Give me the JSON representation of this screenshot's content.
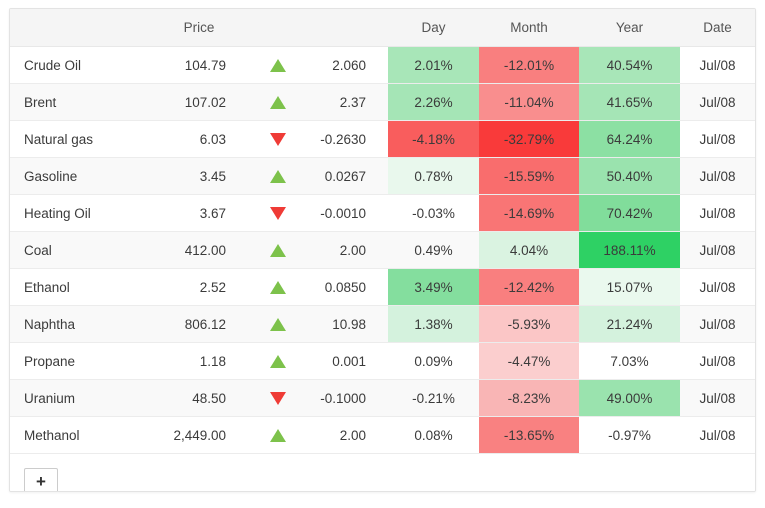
{
  "table": {
    "headers": {
      "name": "",
      "price": "Price",
      "arrow": "",
      "change": "",
      "day": "Day",
      "month": "Month",
      "year": "Year",
      "date": "Date"
    },
    "rows": [
      {
        "name": "Crude Oil",
        "price": "104.79",
        "direction": "up",
        "change": "2.060",
        "day": "2.01%",
        "month": "-12.01%",
        "year": "40.54%",
        "date": "Jul/08",
        "day_bg": "#a8e6b8",
        "month_bg": "#f97f7f",
        "year_bg": "#a8e6b8",
        "day_value": 2.01,
        "month_value": -12.01,
        "year_value": 40.54
      },
      {
        "name": "Brent",
        "price": "107.02",
        "direction": "up",
        "change": "2.37",
        "day": "2.26%",
        "month": "-11.04%",
        "year": "41.65%",
        "date": "Jul/08",
        "day_bg": "#a5e5b6",
        "month_bg": "#f98e8e",
        "year_bg": "#a5e5b6",
        "day_value": 2.26,
        "month_value": -11.04,
        "year_value": 41.65
      },
      {
        "name": "Natural gas",
        "price": "6.03",
        "direction": "down",
        "change": "-0.2630",
        "day": "-4.18%",
        "month": "-32.79%",
        "year": "64.24%",
        "date": "Jul/08",
        "day_bg": "#f95d5d",
        "month_bg": "#f93a3a",
        "year_bg": "#8ce0a3",
        "day_value": -4.18,
        "month_value": -32.79,
        "year_value": 64.24
      },
      {
        "name": "Gasoline",
        "price": "3.45",
        "direction": "up",
        "change": "0.0267",
        "day": "0.78%",
        "month": "-15.59%",
        "year": "50.40%",
        "date": "Jul/08",
        "day_bg": "#e9f8ed",
        "month_bg": "#f96d6d",
        "year_bg": "#9ae3ae",
        "day_value": 0.78,
        "month_value": -15.59,
        "year_value": 50.4
      },
      {
        "name": "Heating Oil",
        "price": "3.67",
        "direction": "down",
        "change": "-0.0010",
        "day": "-0.03%",
        "month": "-14.69%",
        "year": "70.42%",
        "date": "Jul/08",
        "day_bg": "transparent",
        "month_bg": "#f97575",
        "year_bg": "#81dd9b",
        "day_value": -0.03,
        "month_value": -14.69,
        "year_value": 70.42
      },
      {
        "name": "Coal",
        "price": "412.00",
        "direction": "up",
        "change": "2.00",
        "day": "0.49%",
        "month": "4.04%",
        "year": "188.11%",
        "date": "Jul/08",
        "day_bg": "transparent",
        "month_bg": "#daf3e1",
        "year_bg": "#2ed164",
        "day_value": 0.49,
        "month_value": 4.04,
        "year_value": 188.11
      },
      {
        "name": "Ethanol",
        "price": "2.52",
        "direction": "up",
        "change": "0.0850",
        "day": "3.49%",
        "month": "-12.42%",
        "year": "15.07%",
        "date": "Jul/08",
        "day_bg": "#84de9e",
        "month_bg": "#f97f7f",
        "year_bg": "#eaf9ee",
        "day_value": 3.49,
        "month_value": -12.42,
        "year_value": 15.07
      },
      {
        "name": "Naphtha",
        "price": "806.12",
        "direction": "up",
        "change": "10.98",
        "day": "1.38%",
        "month": "-5.93%",
        "year": "21.24%",
        "date": "Jul/08",
        "day_bg": "#d4f2dd",
        "month_bg": "#fbc6c6",
        "year_bg": "#d4f2dd",
        "day_value": 1.38,
        "month_value": -5.93,
        "year_value": 21.24
      },
      {
        "name": "Propane",
        "price": "1.18",
        "direction": "up",
        "change": "0.001",
        "day": "0.09%",
        "month": "-4.47%",
        "year": "7.03%",
        "date": "Jul/08",
        "day_bg": "transparent",
        "month_bg": "#fbcece",
        "year_bg": "transparent",
        "day_value": 0.09,
        "month_value": -4.47,
        "year_value": 7.03
      },
      {
        "name": "Uranium",
        "price": "48.50",
        "direction": "down",
        "change": "-0.1000",
        "day": "-0.21%",
        "month": "-8.23%",
        "year": "49.00%",
        "date": "Jul/08",
        "day_bg": "transparent",
        "month_bg": "#f9b5b5",
        "year_bg": "#9ae3ae",
        "day_value": -0.21,
        "month_value": -8.23,
        "year_value": 49.0
      },
      {
        "name": "Methanol",
        "price": "2,449.00",
        "direction": "up",
        "change": "2.00",
        "day": "0.08%",
        "month": "-13.65%",
        "year": "-0.97%",
        "date": "Jul/08",
        "day_bg": "transparent",
        "month_bg": "#f98181",
        "year_bg": "transparent",
        "day_value": 0.08,
        "month_value": -13.65,
        "year_value": -0.97
      }
    ]
  },
  "footer": {
    "add_label": "+"
  },
  "colors": {
    "header_bg": "#f5f5f5",
    "alt_row_bg": "#f9f9f9",
    "border": "#ececec",
    "up_arrow": "#7dc24b",
    "down_arrow": "#ef3b36",
    "heat_green_max": "#2ed164",
    "heat_red_max": "#f93a3a"
  }
}
